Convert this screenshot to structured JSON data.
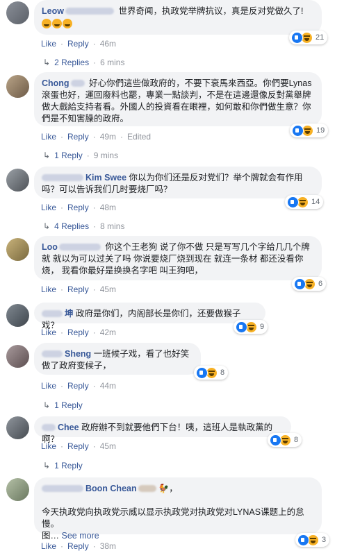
{
  "ui": {
    "like": "Like",
    "reply": "Reply",
    "sep": "·",
    "see_more": "See more",
    "edited": "Edited"
  },
  "comments": [
    {
      "name": "Leow",
      "text": "世界奇闻，执政党举牌抗议，真是反对党做久了!",
      "time": "46m",
      "reactions": "21",
      "replies": "2 Replies",
      "replies_time": "6 mins"
    },
    {
      "name": "Chong",
      "text": "好心你們這些做政府的，不要下衰馬來西亞。你們要Lynas滾蛋也好，運回廢料也罷，專業一點談判，不是在這邊還像反對黨舉牌做大戲給支持者看。外國人的投資看在眼裡，如何敢和你們做生意？你們是不知害臊的政府。",
      "time": "49m",
      "reactions": "19",
      "replies": "1 Reply",
      "replies_time": "9 mins"
    },
    {
      "name": "Kim Swee",
      "text": "你以为你们还是反对党们？举个牌就会有作用吗？可以告诉我们几时要烧厂吗？",
      "time": "48m",
      "reactions": "14",
      "replies": "4 Replies",
      "replies_time": "8 mins"
    },
    {
      "name": "Loo",
      "text": "你这个王老狗 说了你不做 只是写写几个字给几几个牌就 就以为可以过关了吗 你说要烧厂烧到现在 就连一条材 都还没看你烧， 我看你最好是换换名字吧 叫王狗吧，",
      "time": "45m",
      "reactions": "6"
    },
    {
      "name": "坤",
      "text": "政府是你们，内阁部长是你们，还要做猴子戏？",
      "time": "42m",
      "reactions": "9"
    },
    {
      "name": "Sheng",
      "text": "一班候子戏，看了也好笑做了政府变候子，",
      "time": "44m",
      "reactions": "8",
      "replies": "1 Reply"
    },
    {
      "name": "Chee",
      "text": "政府辦不到就要他們下台！咦，這班人是執政黨的啊？",
      "time": "45m",
      "reactions": "8",
      "replies": "1 Reply"
    },
    {
      "name": "Boon Chean",
      "text": "今天执政党向执政党示威以显示执政党对执政党对LYNAS课题上的怠慢。",
      "text2": "图…",
      "time": "38m",
      "reactions": "3"
    }
  ]
}
